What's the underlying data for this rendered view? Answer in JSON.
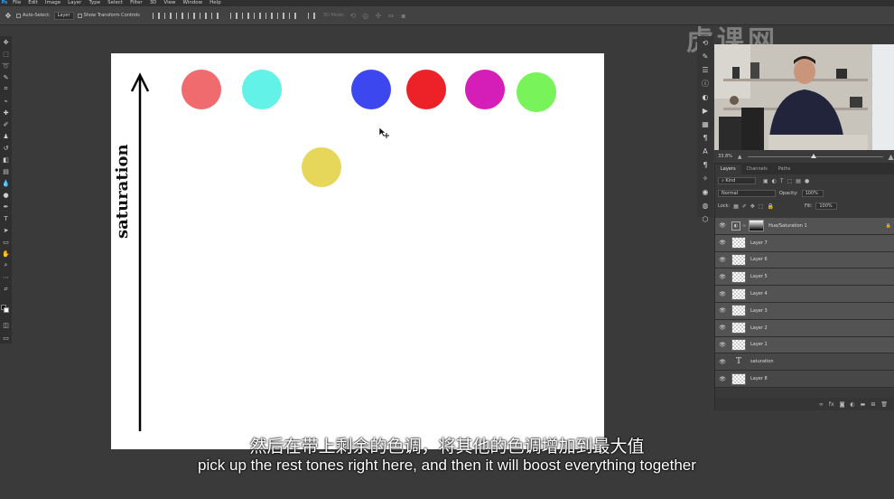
{
  "menubar": {
    "items": [
      "File",
      "Edit",
      "Image",
      "Layer",
      "Type",
      "Select",
      "Filter",
      "3D",
      "View",
      "Window",
      "Help"
    ]
  },
  "options_bar": {
    "auto_select_label": "Auto-Select:",
    "auto_select_value": "Layer",
    "transform_controls_label": "Show Transform Controls",
    "mode_3d_label": "3D Mode:"
  },
  "canvas": {
    "axis_label": "saturation",
    "circles": [
      {
        "name": "circle-light-red",
        "color": "#ef6b6e"
      },
      {
        "name": "circle-cyan",
        "color": "#63f2e7"
      },
      {
        "name": "circle-blue",
        "color": "#3d47f0"
      },
      {
        "name": "circle-red",
        "color": "#ec2228"
      },
      {
        "name": "circle-magenta",
        "color": "#d51eb7"
      },
      {
        "name": "circle-green",
        "color": "#79f35a"
      },
      {
        "name": "circle-yellow",
        "color": "#e6d75a"
      }
    ]
  },
  "watermark": "虎课网",
  "navigator": {
    "zoom": "33.8%",
    "zoom_level": 0.49
  },
  "layers_panel": {
    "tabs": [
      "Layers",
      "Channels",
      "Paths"
    ],
    "filter_kind": "Kind",
    "blend_mode": "Normal",
    "opacity_label": "Opacity:",
    "opacity_value": "100%",
    "lock_label": "Lock:",
    "fill_label": "Fill:",
    "fill_value": "100%",
    "adjustment_layer": "Hue/Saturation 1",
    "layers": [
      "Layer 7",
      "Layer 6",
      "Layer 5",
      "Layer 4",
      "Layer 3",
      "Layer 2",
      "Layer 1",
      "saturation",
      "Layer 8"
    ]
  },
  "subtitles": {
    "zh": "然后在带上剩余的色调，将其他的色调增加到最大值",
    "en": "pick up the rest tones right here, and then it will boost everything together"
  }
}
